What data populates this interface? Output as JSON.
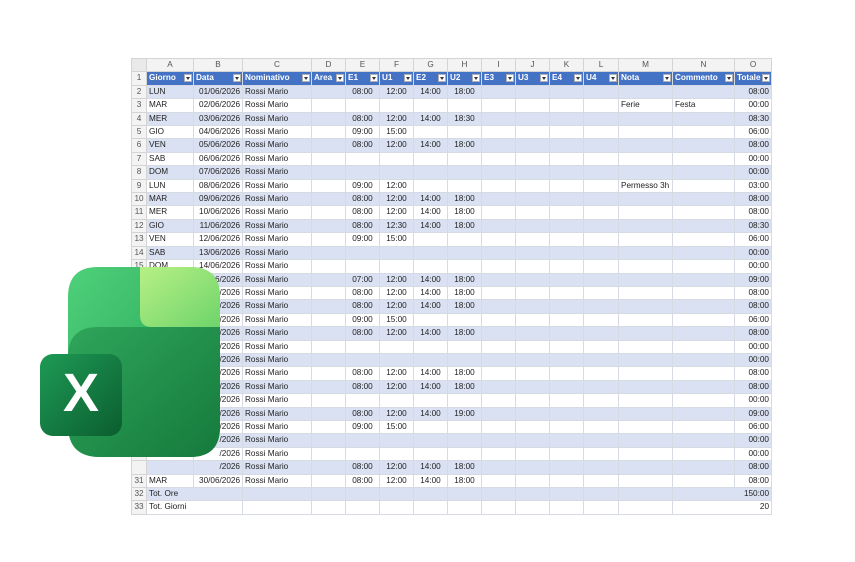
{
  "columns": [
    "A",
    "B",
    "C",
    "D",
    "E",
    "F",
    "G",
    "H",
    "I",
    "J",
    "K",
    "L",
    "M",
    "N",
    "O"
  ],
  "headers": [
    "Giorno",
    "Data",
    "Nominativo",
    "Area",
    "E1",
    "U1",
    "E2",
    "U2",
    "E3",
    "U3",
    "E4",
    "U4",
    "Nota",
    "Commento",
    "Totale"
  ],
  "rows": [
    {
      "n": "2",
      "g": "LUN",
      "d": "01/06/2026",
      "name": "Rossi Mario",
      "e1": "08:00",
      "u1": "12:00",
      "e2": "14:00",
      "u2": "18:00",
      "nota": "",
      "com": "",
      "tot": "08:00"
    },
    {
      "n": "3",
      "g": "MAR",
      "d": "02/06/2026",
      "name": "Rossi Mario",
      "e1": "",
      "u1": "",
      "e2": "",
      "u2": "",
      "nota": "Ferie",
      "com": "Festa",
      "tot": "00:00"
    },
    {
      "n": "4",
      "g": "MER",
      "d": "03/06/2026",
      "name": "Rossi Mario",
      "e1": "08:00",
      "u1": "12:00",
      "e2": "14:00",
      "u2": "18:30",
      "nota": "",
      "com": "",
      "tot": "08:30"
    },
    {
      "n": "5",
      "g": "GIO",
      "d": "04/06/2026",
      "name": "Rossi Mario",
      "e1": "09:00",
      "u1": "15:00",
      "e2": "",
      "u2": "",
      "nota": "",
      "com": "",
      "tot": "06:00"
    },
    {
      "n": "6",
      "g": "VEN",
      "d": "05/06/2026",
      "name": "Rossi Mario",
      "e1": "08:00",
      "u1": "12:00",
      "e2": "14:00",
      "u2": "18:00",
      "nota": "",
      "com": "",
      "tot": "08:00"
    },
    {
      "n": "7",
      "g": "SAB",
      "d": "06/06/2026",
      "name": "Rossi Mario",
      "e1": "",
      "u1": "",
      "e2": "",
      "u2": "",
      "nota": "",
      "com": "",
      "tot": "00:00"
    },
    {
      "n": "8",
      "g": "DOM",
      "d": "07/06/2026",
      "name": "Rossi Mario",
      "e1": "",
      "u1": "",
      "e2": "",
      "u2": "",
      "nota": "",
      "com": "",
      "tot": "00:00"
    },
    {
      "n": "9",
      "g": "LUN",
      "d": "08/06/2026",
      "name": "Rossi Mario",
      "e1": "09:00",
      "u1": "12:00",
      "e2": "",
      "u2": "",
      "nota": "Permesso 3h",
      "com": "",
      "tot": "03:00"
    },
    {
      "n": "10",
      "g": "MAR",
      "d": "09/06/2026",
      "name": "Rossi Mario",
      "e1": "08:00",
      "u1": "12:00",
      "e2": "14:00",
      "u2": "18:00",
      "nota": "",
      "com": "",
      "tot": "08:00"
    },
    {
      "n": "11",
      "g": "MER",
      "d": "10/06/2026",
      "name": "Rossi Mario",
      "e1": "08:00",
      "u1": "12:00",
      "e2": "14:00",
      "u2": "18:00",
      "nota": "",
      "com": "",
      "tot": "08:00"
    },
    {
      "n": "12",
      "g": "GIO",
      "d": "11/06/2026",
      "name": "Rossi Mario",
      "e1": "08:00",
      "u1": "12:30",
      "e2": "14:00",
      "u2": "18:00",
      "nota": "",
      "com": "",
      "tot": "08:30"
    },
    {
      "n": "13",
      "g": "VEN",
      "d": "12/06/2026",
      "name": "Rossi Mario",
      "e1": "09:00",
      "u1": "15:00",
      "e2": "",
      "u2": "",
      "nota": "",
      "com": "",
      "tot": "06:00"
    },
    {
      "n": "14",
      "g": "SAB",
      "d": "13/06/2026",
      "name": "Rossi Mario",
      "e1": "",
      "u1": "",
      "e2": "",
      "u2": "",
      "nota": "",
      "com": "",
      "tot": "00:00"
    },
    {
      "n": "15",
      "g": "DOM",
      "d": "14/06/2026",
      "name": "Rossi Mario",
      "e1": "",
      "u1": "",
      "e2": "",
      "u2": "",
      "nota": "",
      "com": "",
      "tot": "00:00"
    },
    {
      "n": "",
      "g": "",
      "d": "/06/2026",
      "name": "Rossi Mario",
      "e1": "07:00",
      "u1": "12:00",
      "e2": "14:00",
      "u2": "18:00",
      "nota": "",
      "com": "",
      "tot": "09:00"
    },
    {
      "n": "",
      "g": "",
      "d": "/2026",
      "name": "Rossi Mario",
      "e1": "08:00",
      "u1": "12:00",
      "e2": "14:00",
      "u2": "18:00",
      "nota": "",
      "com": "",
      "tot": "08:00"
    },
    {
      "n": "",
      "g": "",
      "d": "/2026",
      "name": "Rossi Mario",
      "e1": "08:00",
      "u1": "12:00",
      "e2": "14:00",
      "u2": "18:00",
      "nota": "",
      "com": "",
      "tot": "08:00"
    },
    {
      "n": "",
      "g": "",
      "d": "/2026",
      "name": "Rossi Mario",
      "e1": "09:00",
      "u1": "15:00",
      "e2": "",
      "u2": "",
      "nota": "",
      "com": "",
      "tot": "06:00"
    },
    {
      "n": "",
      "g": "",
      "d": "/2026",
      "name": "Rossi Mario",
      "e1": "08:00",
      "u1": "12:00",
      "e2": "14:00",
      "u2": "18:00",
      "nota": "",
      "com": "",
      "tot": "08:00"
    },
    {
      "n": "",
      "g": "",
      "d": "/2026",
      "name": "Rossi Mario",
      "e1": "",
      "u1": "",
      "e2": "",
      "u2": "",
      "nota": "",
      "com": "",
      "tot": "00:00"
    },
    {
      "n": "",
      "g": "",
      "d": "/2026",
      "name": "Rossi Mario",
      "e1": "",
      "u1": "",
      "e2": "",
      "u2": "",
      "nota": "",
      "com": "",
      "tot": "00:00"
    },
    {
      "n": "",
      "g": "",
      "d": "/2026",
      "name": "Rossi Mario",
      "e1": "08:00",
      "u1": "12:00",
      "e2": "14:00",
      "u2": "18:00",
      "nota": "",
      "com": "",
      "tot": "08:00"
    },
    {
      "n": "",
      "g": "",
      "d": "/2026",
      "name": "Rossi Mario",
      "e1": "08:00",
      "u1": "12:00",
      "e2": "14:00",
      "u2": "18:00",
      "nota": "",
      "com": "",
      "tot": "08:00"
    },
    {
      "n": "",
      "g": "",
      "d": "/2026",
      "name": "Rossi Mario",
      "e1": "",
      "u1": "",
      "e2": "",
      "u2": "",
      "nota": "",
      "com": "",
      "tot": "00:00"
    },
    {
      "n": "",
      "g": "",
      "d": "/2026",
      "name": "Rossi Mario",
      "e1": "08:00",
      "u1": "12:00",
      "e2": "14:00",
      "u2": "19:00",
      "nota": "",
      "com": "",
      "tot": "09:00"
    },
    {
      "n": "",
      "g": "",
      "d": "/2026",
      "name": "Rossi Mario",
      "e1": "09:00",
      "u1": "15:00",
      "e2": "",
      "u2": "",
      "nota": "",
      "com": "",
      "tot": "06:00"
    },
    {
      "n": "",
      "g": "",
      "d": "/2026",
      "name": "Rossi Mario",
      "e1": "",
      "u1": "",
      "e2": "",
      "u2": "",
      "nota": "",
      "com": "",
      "tot": "00:00"
    },
    {
      "n": "",
      "g": "",
      "d": "/2026",
      "name": "Rossi Mario",
      "e1": "",
      "u1": "",
      "e2": "",
      "u2": "",
      "nota": "",
      "com": "",
      "tot": "00:00"
    },
    {
      "n": "",
      "g": "",
      "d": "/2026",
      "name": "Rossi Mario",
      "e1": "08:00",
      "u1": "12:00",
      "e2": "14:00",
      "u2": "18:00",
      "nota": "",
      "com": "",
      "tot": "08:00"
    },
    {
      "n": "31",
      "g": "MAR",
      "d": "30/06/2026",
      "name": "Rossi Mario",
      "e1": "08:00",
      "u1": "12:00",
      "e2": "14:00",
      "u2": "18:00",
      "nota": "",
      "com": "",
      "tot": "08:00"
    }
  ],
  "totals": [
    {
      "n": "32",
      "label": "Tot. Ore",
      "value": "150:00"
    },
    {
      "n": "33",
      "label": "Tot. Giorni",
      "value": "20"
    }
  ],
  "logo": {
    "letter": "X",
    "icon": "excel-logo-icon",
    "colors": [
      "#21a366",
      "#107c41",
      "#33c481",
      "#185c37"
    ]
  }
}
